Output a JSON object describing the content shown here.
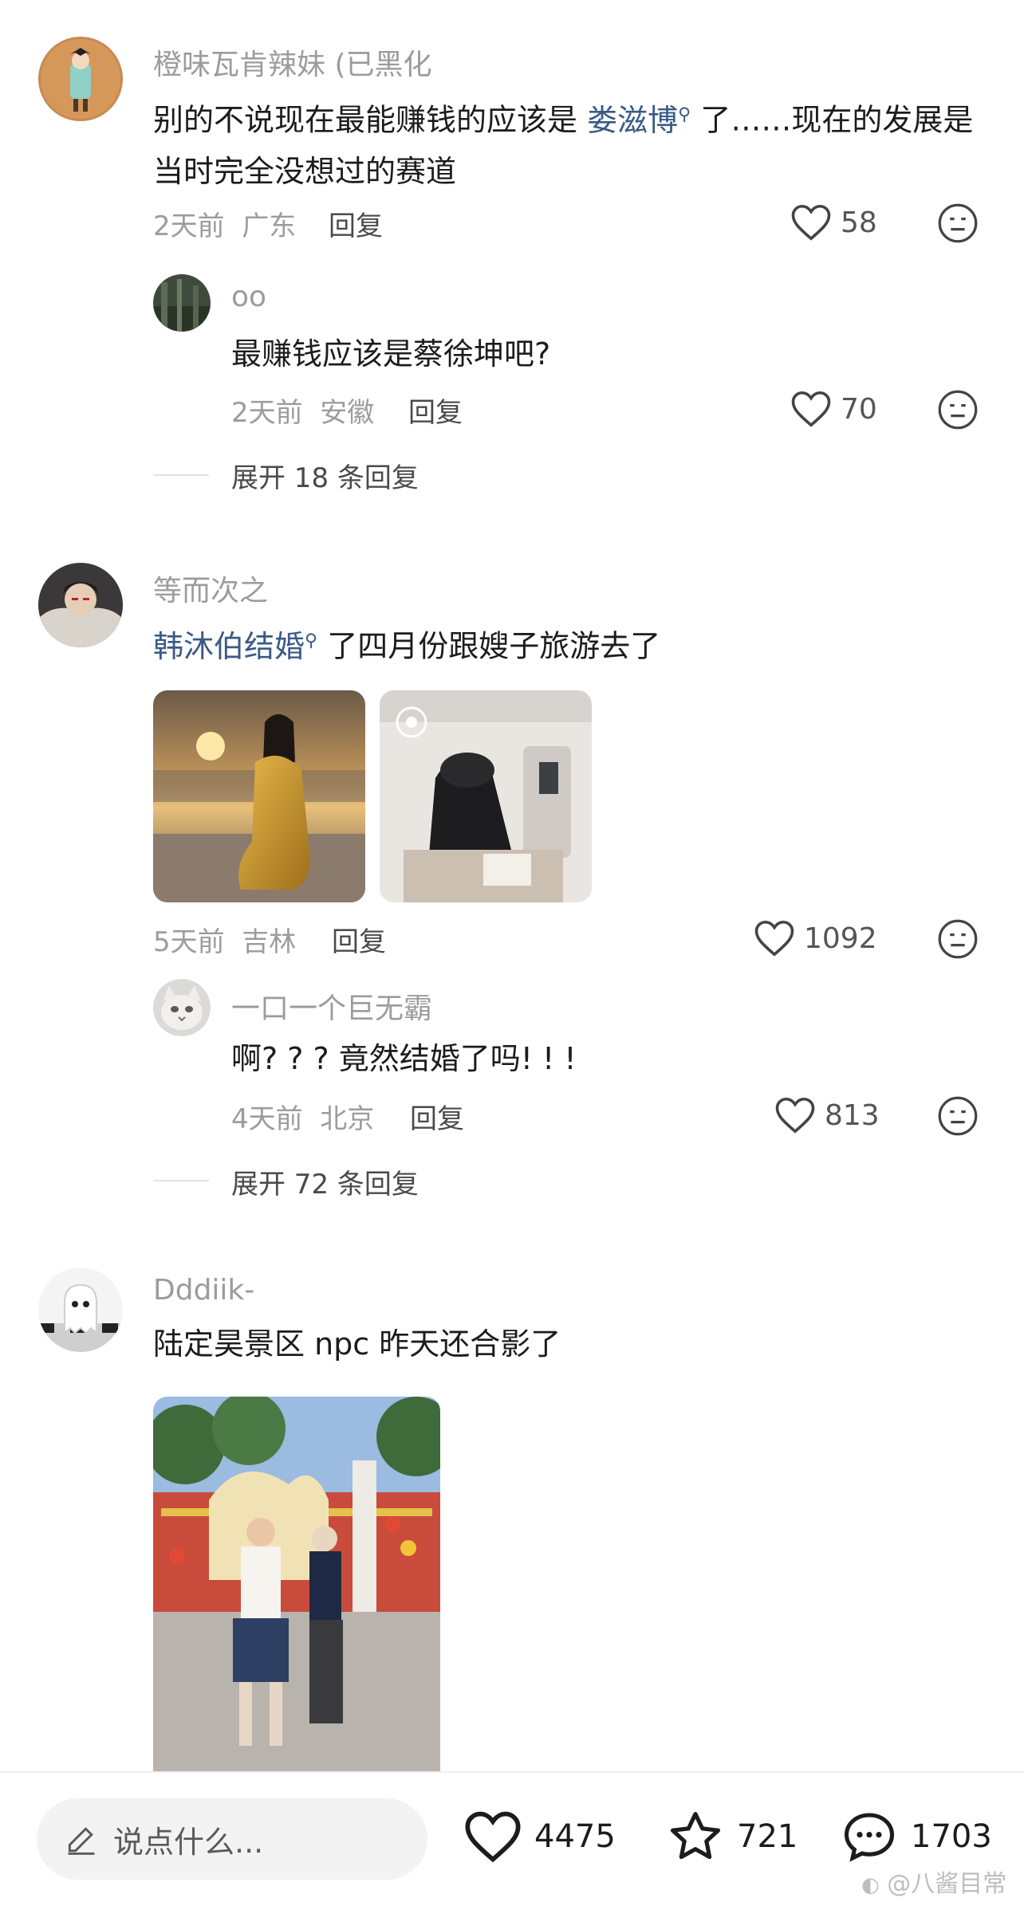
{
  "comments": [
    {
      "username": "橙味瓦肯辣妹 (已黑化",
      "text_before": "别的不说现在最能赚钱的应该是 ",
      "tag": "娄滋博",
      "text_after": " 了……现在的发展是当时完全没想过的赛道",
      "time": "2天前",
      "location": "广东",
      "reply_label": "回复",
      "likes": "58",
      "sub_reply": {
        "username": "oo",
        "text": "最赚钱应该是蔡徐坤吧?",
        "time": "2天前",
        "location": "安徽",
        "reply_label": "回复",
        "likes": "70"
      },
      "expand": "展开 18 条回复"
    },
    {
      "username": "等而次之",
      "tag": "韩沐伯结婚",
      "text_after": " 了四月份跟嫂子旅游去了",
      "time": "5天前",
      "location": "吉林",
      "reply_label": "回复",
      "likes": "1092",
      "sub_reply": {
        "username": "一口一个巨无霸",
        "text": "啊? ? ? 竟然结婚了吗! ! !",
        "time": "4天前",
        "location": "北京",
        "reply_label": "回复",
        "likes": "813"
      },
      "expand": "展开 72 条回复"
    },
    {
      "username": "Dddiik-",
      "text": "陆定昊景区 npc 昨天还合影了"
    }
  ],
  "bottom_bar": {
    "input_placeholder": "说点什么...",
    "likes": "4475",
    "favorites": "721",
    "comments": "1703"
  },
  "watermark": "@八酱目常",
  "colors": {
    "tag_link": "#3b5a85",
    "muted": "#9c9c9c",
    "text": "#1c1c1c"
  },
  "icons": [
    "heart-icon",
    "meh-face-icon",
    "search-tag-icon",
    "pencil-icon",
    "star-icon",
    "chat-bubble-icon",
    "weibo-icon"
  ]
}
